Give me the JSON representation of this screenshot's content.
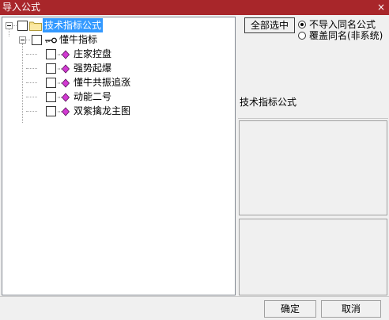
{
  "window": {
    "title": "导入公式",
    "close_glyph": "×"
  },
  "tree": {
    "root": {
      "label": "技术指标公式"
    },
    "group": {
      "label": "懂牛指标"
    },
    "items": [
      {
        "label": "庄家控盘"
      },
      {
        "label": "强势起爆"
      },
      {
        "label": "懂牛共振追涨"
      },
      {
        "label": "动能二号"
      },
      {
        "label": "双紫擒龙主图"
      }
    ]
  },
  "options": {
    "select_all_label": "全部选中",
    "radio_skip_label": "不导入同名公式",
    "radio_overwrite_label": "覆盖同名(非系统)"
  },
  "detail": {
    "formula_type": "技术指标公式"
  },
  "footer": {
    "ok_label": "确定",
    "cancel_label": "取消"
  },
  "colors": {
    "titlebar": "#a8262a",
    "selection": "#3399ff",
    "formula_icon": "#d23ad2"
  }
}
